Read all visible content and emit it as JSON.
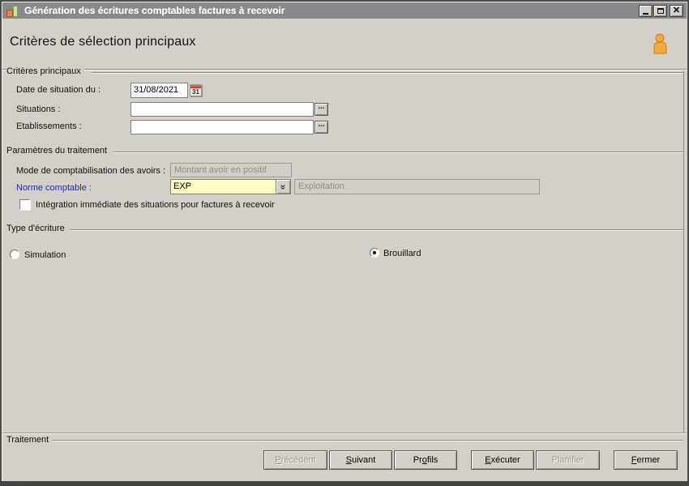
{
  "window": {
    "title": "Génération des écritures comptables factures à recevoir",
    "icon": "bar-chart-app-icon",
    "controls": {
      "minimize": "minimize",
      "maximize": "maximize",
      "close_glyph": "x"
    }
  },
  "header": {
    "title": "Critères de sélection principaux",
    "user_icon": "user-icon"
  },
  "groups": {
    "criteres": {
      "label": "Critères principaux",
      "date_label": "Date de situation du :",
      "date_value": "31/08/2021",
      "calendar_day": "31",
      "situations_label": "Situations :",
      "situations_value": "",
      "etablissements_label": "Etablissements :",
      "etablissements_value": "",
      "browse_glyph": "..."
    },
    "parametres": {
      "label": "Paramètres du traitement",
      "mode_label": "Mode de comptabilisation des avoirs :",
      "mode_value": "Montant avoir en positif",
      "norme_label": "Norme comptable :",
      "norme_value": "EXP",
      "norme_dropdown_glyph": "»",
      "norme_desc": "Exploitation",
      "checkbox_label": "Intégration immédiate des situations pour factures à recevoir",
      "checkbox_checked": false
    },
    "type_ecriture": {
      "label": "Type d'écriture",
      "options": [
        {
          "label": "Simulation",
          "selected": false
        },
        {
          "label": "Brouillard",
          "selected": true
        }
      ]
    },
    "traitement": {
      "label": "Traitement"
    }
  },
  "footer": {
    "buttons": [
      {
        "pre": "",
        "u": "P",
        "post": "récédent",
        "disabled": true
      },
      {
        "pre": "",
        "u": "S",
        "post": "uivant",
        "disabled": false
      },
      {
        "pre": "Pr",
        "u": "o",
        "post": "fils",
        "disabled": false
      },
      {
        "pre": "",
        "u": "E",
        "post": "xécuter",
        "disabled": false
      },
      {
        "pre": "Planifier",
        "u": "",
        "post": "",
        "disabled": true
      },
      {
        "pre": "",
        "u": "F",
        "post": "ermer",
        "disabled": false
      }
    ]
  },
  "colors": {
    "dialog_bg": "#d4d0c8",
    "titlebar_bg": "#89898d",
    "combo_bg": "#ffffc4",
    "disabled_field_bg": "#d2cfc7",
    "disabled_text": "#8f8f89",
    "blue_label": "#1f1fbe",
    "user_icon_orange": "#f2a93b",
    "calendar_red": "#e0603a",
    "frame_dark": "#4a4a4a"
  }
}
